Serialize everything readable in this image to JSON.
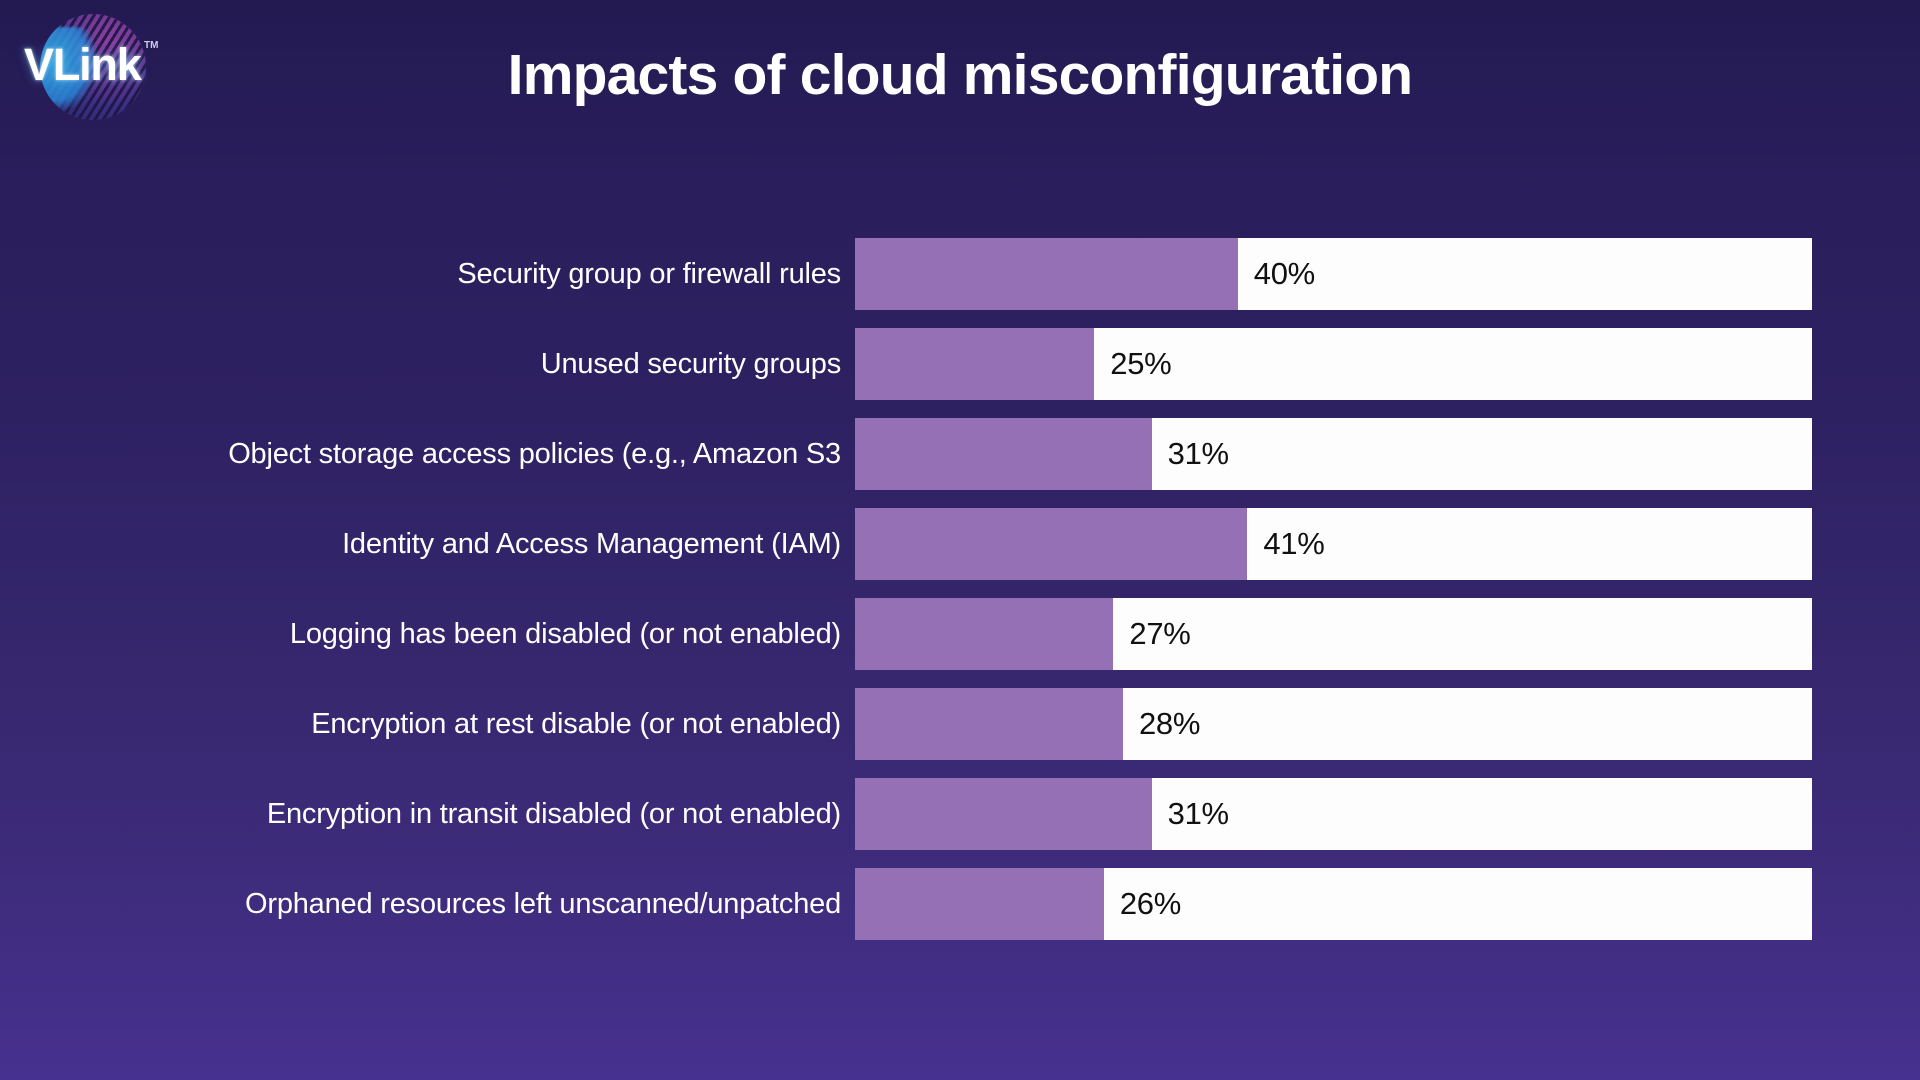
{
  "brand": {
    "name": "VLink",
    "trademark": "TM",
    "logo_icon": "globe-icon",
    "globe_colors": [
      "#8b3f9e",
      "#3a2f82",
      "#35b6e8"
    ]
  },
  "chart_data": {
    "type": "bar",
    "orientation": "horizontal",
    "title": "Impacts of cloud misconfiguration",
    "subtitle": "",
    "xlabel": "",
    "ylabel": "",
    "xlim": [
      0,
      100
    ],
    "grid": false,
    "legend": null,
    "value_suffix": "%",
    "colors": {
      "bar_fill": "#9670b4",
      "track": "#fdfdfd",
      "value_text": "#111111",
      "label_text": "#ffffff",
      "background_top": "#231a52",
      "background_bottom": "#473190"
    },
    "categories": [
      "Security group or firewall rules",
      "Unused security groups",
      "Object storage access policies (e.g., Amazon S3",
      "Identity and Access Management (IAM)",
      "Logging has been disabled (or not enabled)",
      "Encryption at rest disable (or not enabled)",
      "Encryption in transit disabled (or not enabled)",
      "Orphaned resources left unscanned/unpatched"
    ],
    "values": [
      40,
      25,
      31,
      41,
      27,
      28,
      31,
      26
    ],
    "value_labels": [
      "40%",
      "25%",
      "31%",
      "41%",
      "27%",
      "28%",
      "31%",
      "26%"
    ],
    "bars": [
      {
        "label": "Security group or firewall rules",
        "value": 40,
        "value_label": "40%"
      },
      {
        "label": "Unused security groups",
        "value": 25,
        "value_label": "25%"
      },
      {
        "label": "Object storage access policies (e.g., Amazon S3",
        "value": 31,
        "value_label": "31%"
      },
      {
        "label": "Identity and Access Management (IAM)",
        "value": 41,
        "value_label": "41%"
      },
      {
        "label": "Logging has been disabled (or not enabled)",
        "value": 27,
        "value_label": "27%"
      },
      {
        "label": "Encryption at rest disable (or not enabled)",
        "value": 28,
        "value_label": "28%"
      },
      {
        "label": "Encryption in transit disabled (or not enabled)",
        "value": 31,
        "value_label": "31%"
      },
      {
        "label": "Orphaned resources left unscanned/unpatched",
        "value": 26,
        "value_label": "26%"
      }
    ]
  }
}
